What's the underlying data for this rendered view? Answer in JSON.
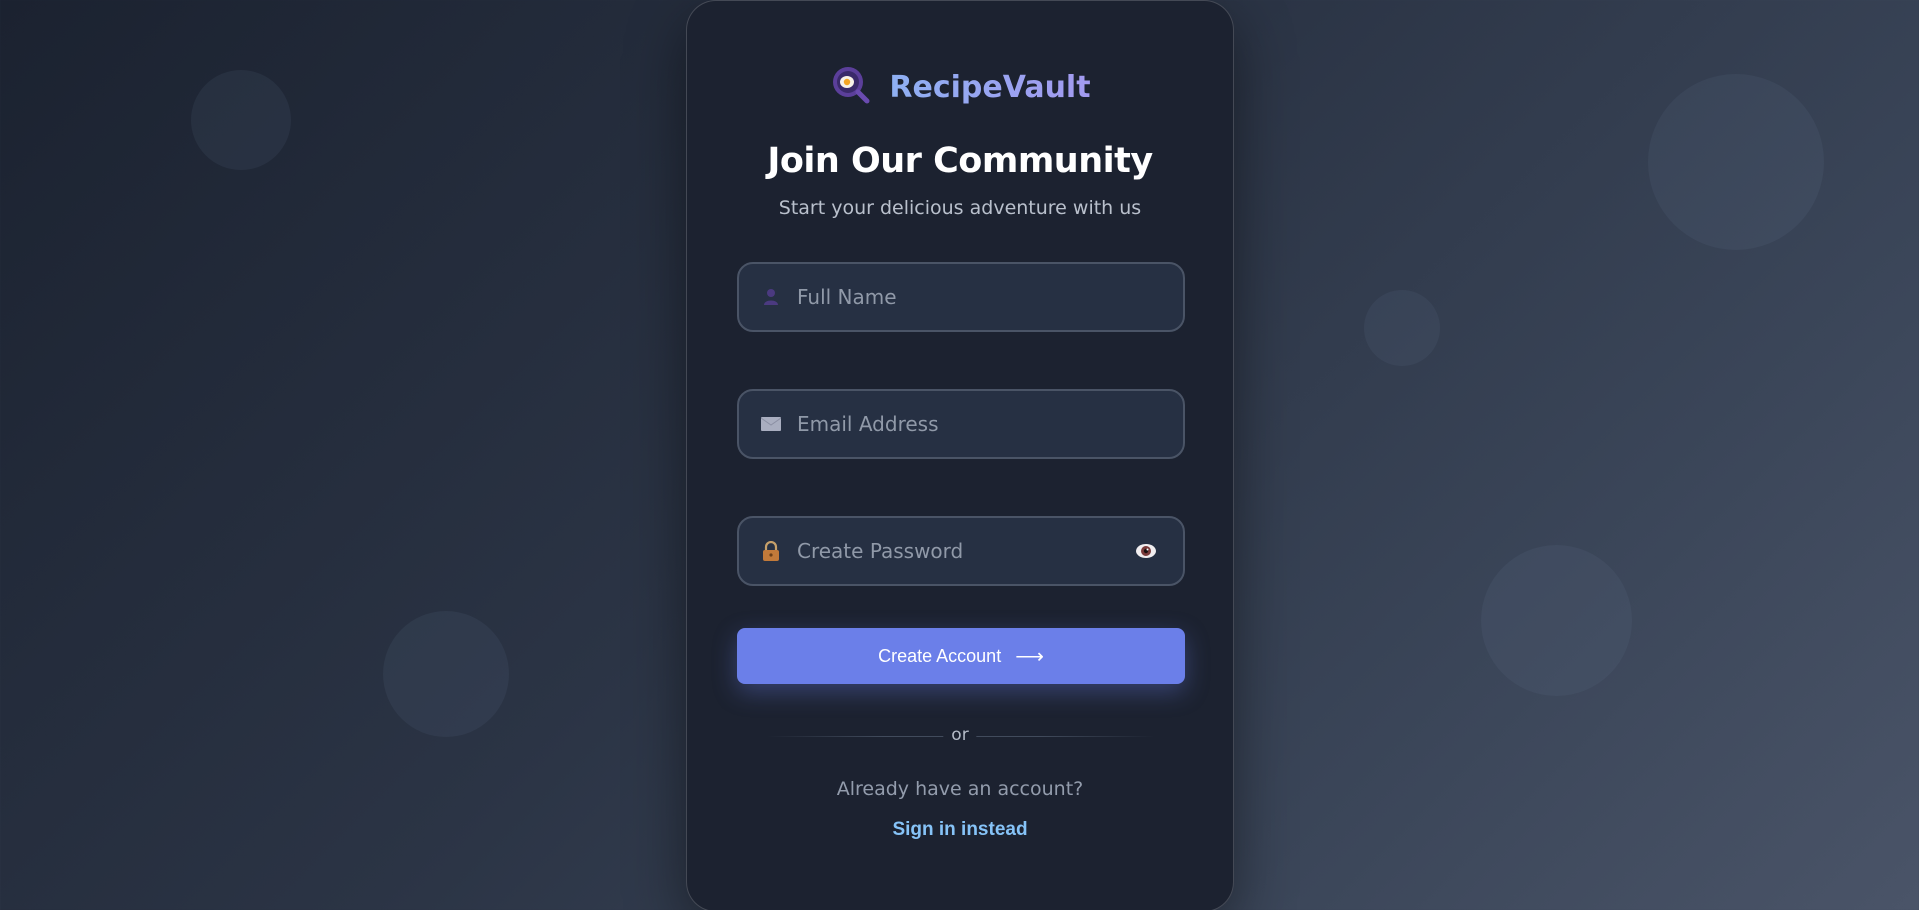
{
  "brand": {
    "name": "RecipeVault",
    "icon": "frying-pan-egg-icon"
  },
  "heading": {
    "title": "Join Our Community",
    "subtitle": "Start your delicious adventure with us"
  },
  "form": {
    "full_name": {
      "placeholder": "Full Name",
      "value": "",
      "icon": "user-icon"
    },
    "email": {
      "placeholder": "Email Address",
      "value": "",
      "icon": "envelope-icon"
    },
    "password": {
      "placeholder": "Create Password",
      "value": "",
      "icon": "lock-icon",
      "toggle_icon": "eye-icon"
    },
    "submit": {
      "label": "Create Account",
      "arrow": "⟶"
    }
  },
  "divider": {
    "label": "or"
  },
  "footer": {
    "prompt": "Already have an account?",
    "link": "Sign in instead"
  },
  "colors": {
    "accent": "#6b7fe9",
    "link": "#86c3f7",
    "card": "#1c2230",
    "field_bg": "#263043"
  }
}
